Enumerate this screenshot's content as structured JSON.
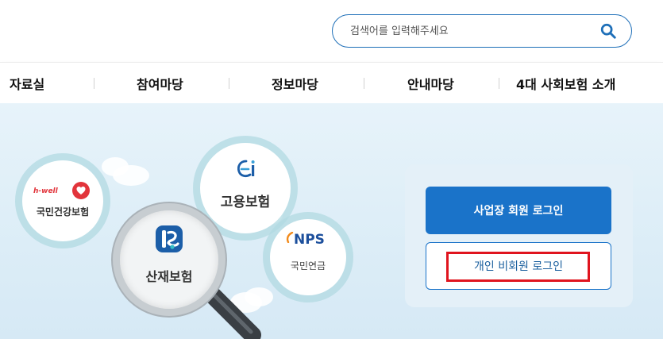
{
  "search": {
    "placeholder": "검색어를 입력해주세요"
  },
  "nav": {
    "items": [
      "자료실",
      "참여마당",
      "정보마당",
      "안내마당",
      "4대 사회보험 소개"
    ]
  },
  "services": {
    "health": {
      "brand": "h-well",
      "label": "국민건강보험"
    },
    "employment": {
      "label": "고용보험"
    },
    "pension": {
      "brand": "NPS",
      "label": "국민연금"
    },
    "industrial": {
      "label": "산재보험"
    }
  },
  "login": {
    "business_label": "사업장 회원 로그인",
    "personal_label": "개인 비회원 로그인"
  },
  "colors": {
    "primary": "#1a73c9",
    "highlight": "#e0141e",
    "health_red": "#e2343b",
    "pension_orange": "#f28a1a",
    "employment_blue": "#1c5ea8"
  }
}
